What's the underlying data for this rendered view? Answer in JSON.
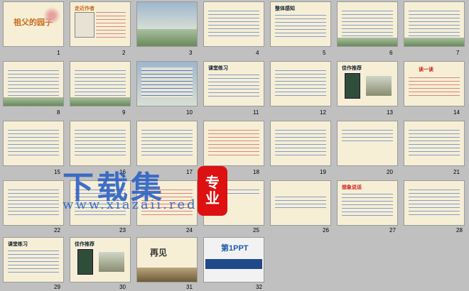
{
  "slides": [
    {
      "num": "1",
      "title": "祖父的园子"
    },
    {
      "num": "2",
      "title": "走近作者"
    },
    {
      "num": "3"
    },
    {
      "num": "4"
    },
    {
      "num": "5",
      "title": "整体感知"
    },
    {
      "num": "6"
    },
    {
      "num": "7"
    },
    {
      "num": "8"
    },
    {
      "num": "9"
    },
    {
      "num": "10"
    },
    {
      "num": "11",
      "title": "课堂练习"
    },
    {
      "num": "12"
    },
    {
      "num": "13",
      "title": "佳作推荐"
    },
    {
      "num": "14",
      "title": "读一读"
    },
    {
      "num": "15"
    },
    {
      "num": "16"
    },
    {
      "num": "17"
    },
    {
      "num": "18"
    },
    {
      "num": "19"
    },
    {
      "num": "20"
    },
    {
      "num": "21"
    },
    {
      "num": "22"
    },
    {
      "num": "23"
    },
    {
      "num": "24"
    },
    {
      "num": "25"
    },
    {
      "num": "26"
    },
    {
      "num": "27",
      "title": "想象说话"
    },
    {
      "num": "28"
    },
    {
      "num": "29",
      "title": "课堂练习"
    },
    {
      "num": "30",
      "title": "佳作推荐"
    },
    {
      "num": "31",
      "title": "再见"
    },
    {
      "num": "32",
      "logo": "第1PPT"
    }
  ],
  "watermark": {
    "title": "下载集",
    "url": "www.xiazaii.red",
    "badge_top": "专",
    "badge_bottom": "业"
  }
}
